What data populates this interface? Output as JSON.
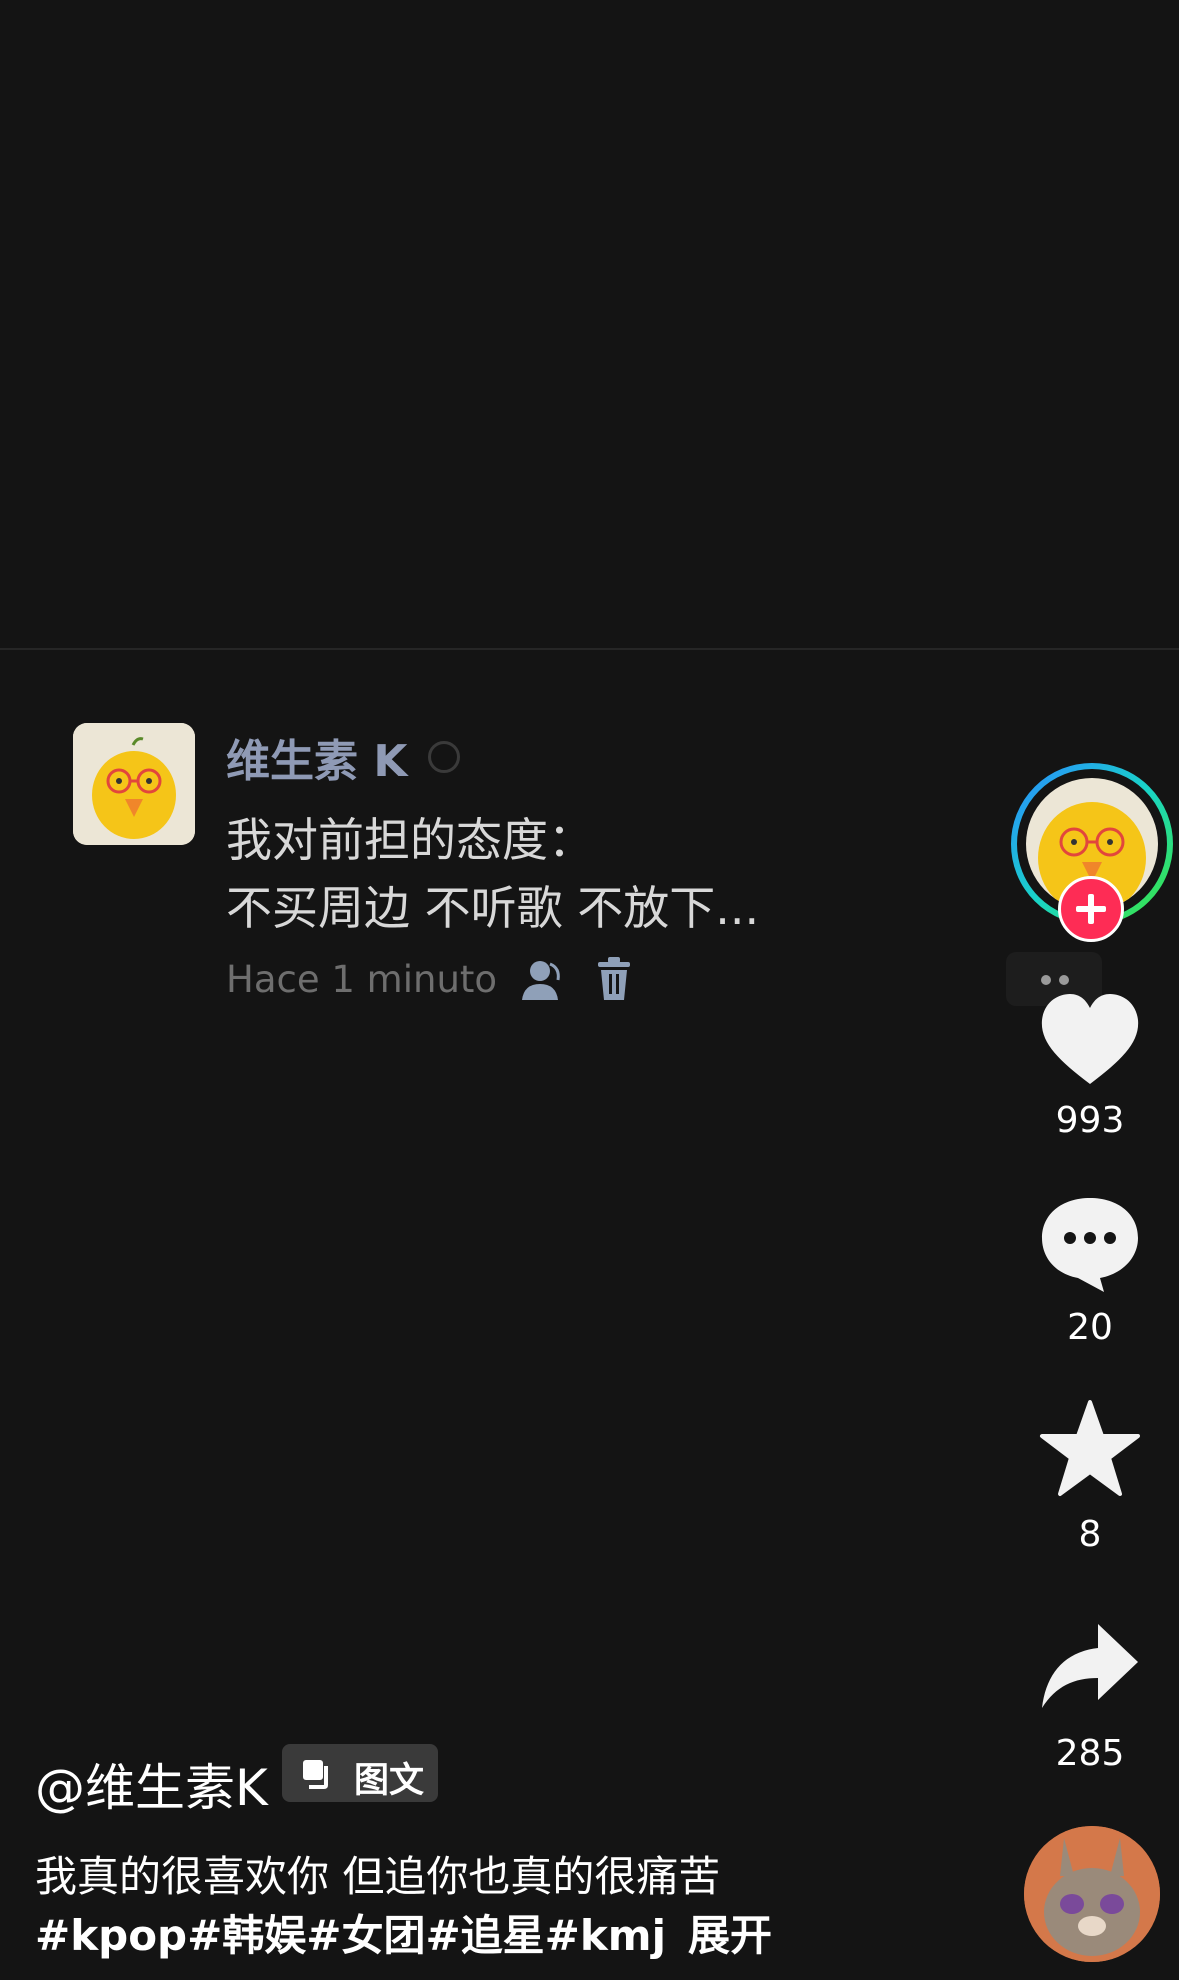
{
  "post": {
    "author_name": "维生素 K",
    "text_line1": "我对前担的态度：",
    "text_line2": "不买周边 不听歌 不放下...",
    "time": "Hace 1 minuto"
  },
  "actions": {
    "like_count": "993",
    "comment_count": "20",
    "favorite_count": "8",
    "share_count": "285"
  },
  "caption": {
    "author": "@维生素K",
    "type_badge": "图文",
    "text": "我真的很喜欢你 但追你也真的很痛苦",
    "hashtags": "#kpop#韩娱#女团#追星#kmj",
    "expand": "展开"
  },
  "colors": {
    "background": "#141414",
    "follow_accent": "#fe2c55",
    "author_name": "#8f9ab5"
  }
}
